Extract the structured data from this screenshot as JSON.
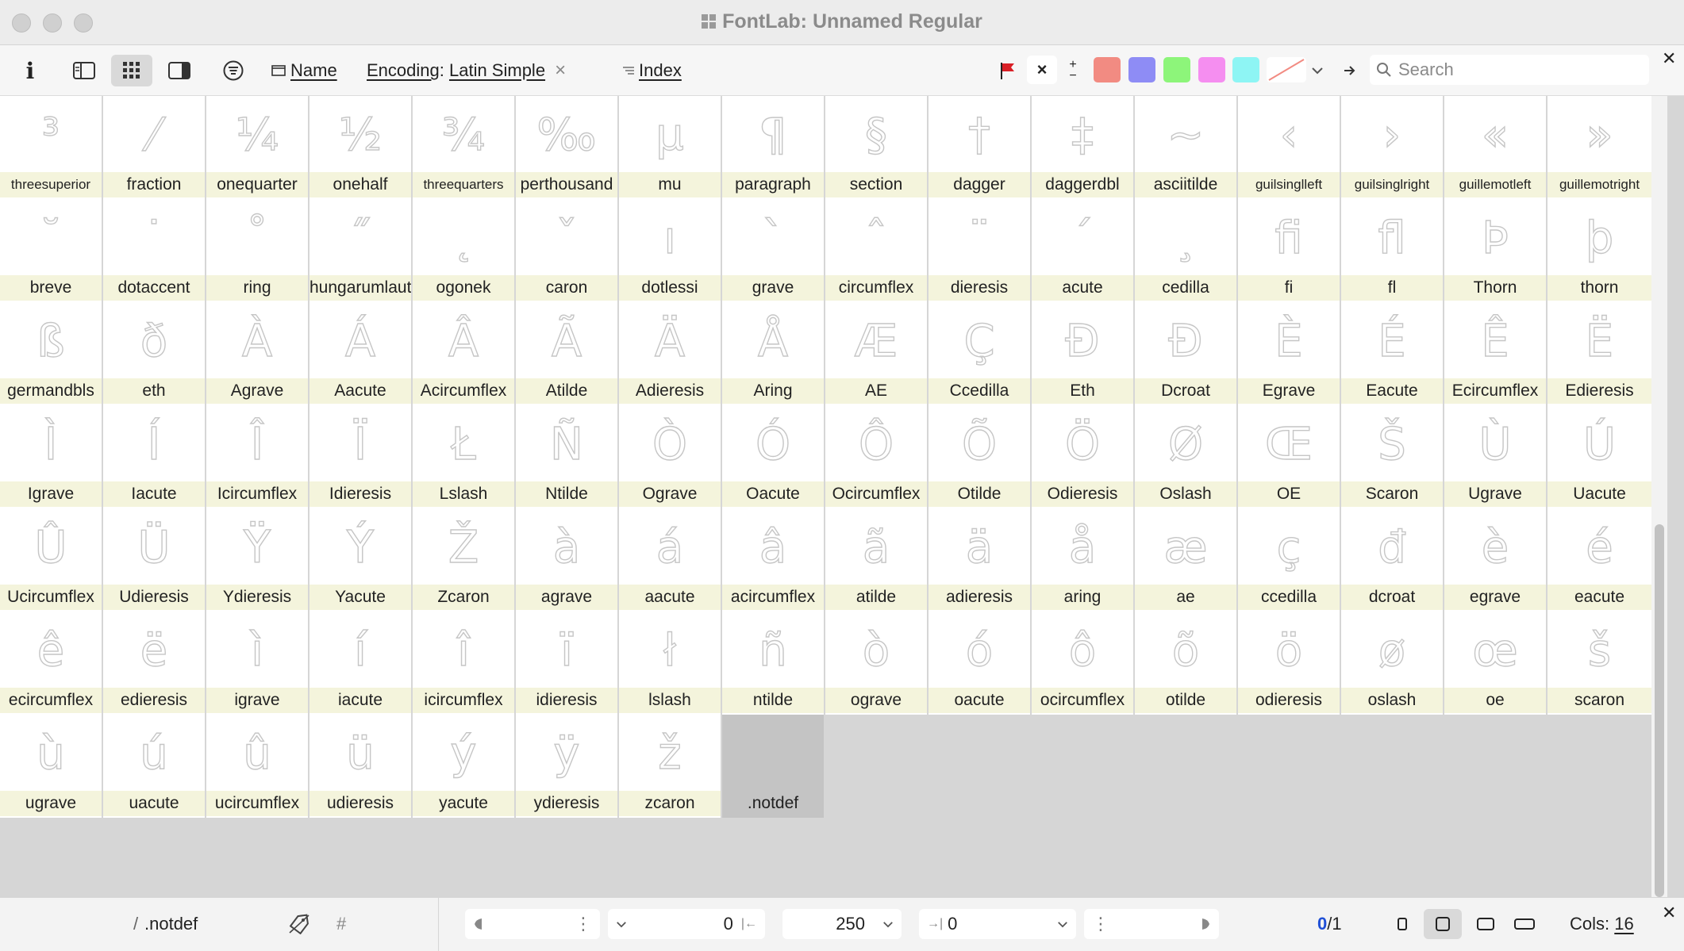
{
  "window": {
    "title": "FontLab: Unnamed Regular"
  },
  "toolbar": {
    "info_label": "i",
    "name_label": "Name",
    "encoding_label": "Encoding",
    "encoding_value": "Latin Simple",
    "encoding_clear": "×",
    "index_label": "Index",
    "flag_clear": "×",
    "search_placeholder": "Search",
    "colors": [
      "#f28b82",
      "#8e8cf5",
      "#8df57a",
      "#f58ef0",
      "#8ef5f4"
    ]
  },
  "glyphs": [
    {
      "g": "³",
      "n": "threesuperior"
    },
    {
      "g": "⁄",
      "n": "fraction"
    },
    {
      "g": "¼",
      "n": "onequarter"
    },
    {
      "g": "½",
      "n": "onehalf"
    },
    {
      "g": "¾",
      "n": "threequarters"
    },
    {
      "g": "‰",
      "n": "perthousand"
    },
    {
      "g": "µ",
      "n": "mu"
    },
    {
      "g": "¶",
      "n": "paragraph"
    },
    {
      "g": "§",
      "n": "section"
    },
    {
      "g": "†",
      "n": "dagger"
    },
    {
      "g": "‡",
      "n": "daggerdbl"
    },
    {
      "g": "~",
      "n": "asciitilde"
    },
    {
      "g": "‹",
      "n": "guilsinglleft"
    },
    {
      "g": "›",
      "n": "guilsinglright"
    },
    {
      "g": "«",
      "n": "guillemotleft"
    },
    {
      "g": "»",
      "n": "guillemotright"
    },
    {
      "g": "˘",
      "n": "breve"
    },
    {
      "g": "˙",
      "n": "dotaccent"
    },
    {
      "g": "˚",
      "n": "ring"
    },
    {
      "g": "˝",
      "n": "hungarumlaut"
    },
    {
      "g": "˛",
      "n": "ogonek"
    },
    {
      "g": "ˇ",
      "n": "caron"
    },
    {
      "g": "ı",
      "n": "dotlessi"
    },
    {
      "g": "`",
      "n": "grave"
    },
    {
      "g": "ˆ",
      "n": "circumflex"
    },
    {
      "g": "¨",
      "n": "dieresis"
    },
    {
      "g": "´",
      "n": "acute"
    },
    {
      "g": "¸",
      "n": "cedilla"
    },
    {
      "g": "ﬁ",
      "n": "fi"
    },
    {
      "g": "ﬂ",
      "n": "fl"
    },
    {
      "g": "Þ",
      "n": "Thorn"
    },
    {
      "g": "þ",
      "n": "thorn"
    },
    {
      "g": "ß",
      "n": "germandbls"
    },
    {
      "g": "ð",
      "n": "eth"
    },
    {
      "g": "À",
      "n": "Agrave"
    },
    {
      "g": "Á",
      "n": "Aacute"
    },
    {
      "g": "Â",
      "n": "Acircumflex"
    },
    {
      "g": "Ã",
      "n": "Atilde"
    },
    {
      "g": "Ä",
      "n": "Adieresis"
    },
    {
      "g": "Å",
      "n": "Aring"
    },
    {
      "g": "Æ",
      "n": "AE"
    },
    {
      "g": "Ç",
      "n": "Ccedilla"
    },
    {
      "g": "Ð",
      "n": "Eth"
    },
    {
      "g": "Đ",
      "n": "Dcroat"
    },
    {
      "g": "È",
      "n": "Egrave"
    },
    {
      "g": "É",
      "n": "Eacute"
    },
    {
      "g": "Ê",
      "n": "Ecircumflex"
    },
    {
      "g": "Ë",
      "n": "Edieresis"
    },
    {
      "g": "Ì",
      "n": "Igrave"
    },
    {
      "g": "Í",
      "n": "Iacute"
    },
    {
      "g": "Î",
      "n": "Icircumflex"
    },
    {
      "g": "Ï",
      "n": "Idieresis"
    },
    {
      "g": "Ł",
      "n": "Lslash"
    },
    {
      "g": "Ñ",
      "n": "Ntilde"
    },
    {
      "g": "Ò",
      "n": "Ograve"
    },
    {
      "g": "Ó",
      "n": "Oacute"
    },
    {
      "g": "Ô",
      "n": "Ocircumflex"
    },
    {
      "g": "Õ",
      "n": "Otilde"
    },
    {
      "g": "Ö",
      "n": "Odieresis"
    },
    {
      "g": "Ø",
      "n": "Oslash"
    },
    {
      "g": "Œ",
      "n": "OE"
    },
    {
      "g": "Š",
      "n": "Scaron"
    },
    {
      "g": "Ù",
      "n": "Ugrave"
    },
    {
      "g": "Ú",
      "n": "Uacute"
    },
    {
      "g": "Û",
      "n": "Ucircumflex"
    },
    {
      "g": "Ü",
      "n": "Udieresis"
    },
    {
      "g": "Ÿ",
      "n": "Ydieresis"
    },
    {
      "g": "Ý",
      "n": "Yacute"
    },
    {
      "g": "Ž",
      "n": "Zcaron"
    },
    {
      "g": "à",
      "n": "agrave"
    },
    {
      "g": "á",
      "n": "aacute"
    },
    {
      "g": "â",
      "n": "acircumflex"
    },
    {
      "g": "ã",
      "n": "atilde"
    },
    {
      "g": "ä",
      "n": "adieresis"
    },
    {
      "g": "å",
      "n": "aring"
    },
    {
      "g": "æ",
      "n": "ae"
    },
    {
      "g": "ç",
      "n": "ccedilla"
    },
    {
      "g": "đ",
      "n": "dcroat"
    },
    {
      "g": "è",
      "n": "egrave"
    },
    {
      "g": "é",
      "n": "eacute"
    },
    {
      "g": "ê",
      "n": "ecircumflex"
    },
    {
      "g": "ë",
      "n": "edieresis"
    },
    {
      "g": "ì",
      "n": "igrave"
    },
    {
      "g": "í",
      "n": "iacute"
    },
    {
      "g": "î",
      "n": "icircumflex"
    },
    {
      "g": "ï",
      "n": "idieresis"
    },
    {
      "g": "ł",
      "n": "lslash"
    },
    {
      "g": "ñ",
      "n": "ntilde"
    },
    {
      "g": "ò",
      "n": "ograve"
    },
    {
      "g": "ó",
      "n": "oacute"
    },
    {
      "g": "ô",
      "n": "ocircumflex"
    },
    {
      "g": "õ",
      "n": "otilde"
    },
    {
      "g": "ö",
      "n": "odieresis"
    },
    {
      "g": "ø",
      "n": "oslash"
    },
    {
      "g": "œ",
      "n": "oe"
    },
    {
      "g": "š",
      "n": "scaron"
    },
    {
      "g": "ù",
      "n": "ugrave"
    },
    {
      "g": "ú",
      "n": "uacute"
    },
    {
      "g": "û",
      "n": "ucircumflex"
    },
    {
      "g": "ü",
      "n": "udieresis"
    },
    {
      "g": "ý",
      "n": "yacute"
    },
    {
      "g": "ÿ",
      "n": "ydieresis"
    },
    {
      "g": "ž",
      "n": "zcaron"
    },
    {
      "g": "",
      "n": ".notdef"
    }
  ],
  "status": {
    "slash": "/",
    "glyph_name": ".notdef",
    "hash": "#",
    "left_value": "0",
    "width_value": "250",
    "right_value": "0",
    "sel_count": "0",
    "sel_total": "/1",
    "cols_label": "Cols:",
    "cols_value": "16"
  }
}
